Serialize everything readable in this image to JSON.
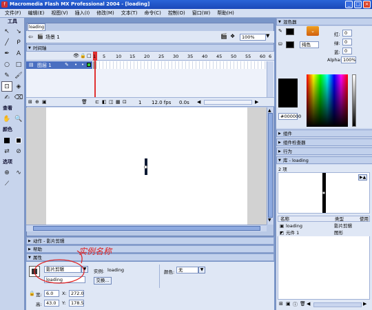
{
  "window": {
    "title": "Macromedia Flash MX Professional 2004 - [loading]",
    "min": "_",
    "max": "□",
    "close": "×"
  },
  "menu": [
    "文件(F)",
    "编辑(E)",
    "视图(V)",
    "插入(I)",
    "修改(M)",
    "文本(T)",
    "命令(C)",
    "控制(O)",
    "窗口(W)",
    "帮助(H)"
  ],
  "tools": {
    "title": "工具",
    "view_label": "查看",
    "colors_label": "颜色",
    "options_label": "选项",
    "items": [
      "↖",
      "↘",
      "╱",
      "ᑭ",
      "✒",
      "A",
      "○",
      "□",
      "✎",
      "🖌",
      "⊡",
      "◈",
      "✍",
      "⌫",
      "✋",
      "🔍"
    ]
  },
  "document": {
    "tab_label": "loading",
    "scene_label": "场景 1",
    "zoom": "100%"
  },
  "timeline": {
    "title": "时间轴",
    "layer_name": "图层 1",
    "frame_numbers": [
      "1",
      "5",
      "10",
      "15",
      "20",
      "25",
      "30",
      "35",
      "40",
      "45",
      "50",
      "55",
      "60",
      "6"
    ],
    "current_frame": "1",
    "fps": "12.0 fps",
    "time": "0.0s"
  },
  "panels": {
    "actions": "动作 - 影片剪辑",
    "help": "帮助",
    "properties": "属性"
  },
  "properties": {
    "type_select": "影片剪辑",
    "instance_name": "loading",
    "instance_label": "实例:",
    "instance_of": "loading",
    "swap_button": "交换...",
    "color_label": "颜色:",
    "color_value": "无",
    "w_label": "宽:",
    "w_value": "6.0",
    "h_label": "高:",
    "h_value": "43.0",
    "x_label": "X:",
    "x_value": "272.0",
    "y_label": "Y:",
    "y_value": "178.5",
    "annotation": "实例名称"
  },
  "mixer": {
    "title": "混色器",
    "r_label": "红:",
    "r_value": "0",
    "g_label": "绿:",
    "g_value": "0",
    "b_label": "蓝:",
    "b_value": "0",
    "alpha_label": "Alpha:",
    "alpha_value": "100%",
    "fill_type": "纯色",
    "hex": "#000000"
  },
  "side_panels": {
    "components": "组件",
    "inspector": "组件检查器",
    "behaviors": "行为",
    "library": "库 - loading"
  },
  "library": {
    "count": "2 项",
    "col_name": "名称",
    "col_type": "类型",
    "col_usage": "使用",
    "items": [
      {
        "name": "loading",
        "type": "影片剪辑"
      },
      {
        "name": "元件 1",
        "type": "图形"
      }
    ]
  },
  "colors": {
    "titlebar": "#1a48b8",
    "annotation": "#e02020"
  }
}
